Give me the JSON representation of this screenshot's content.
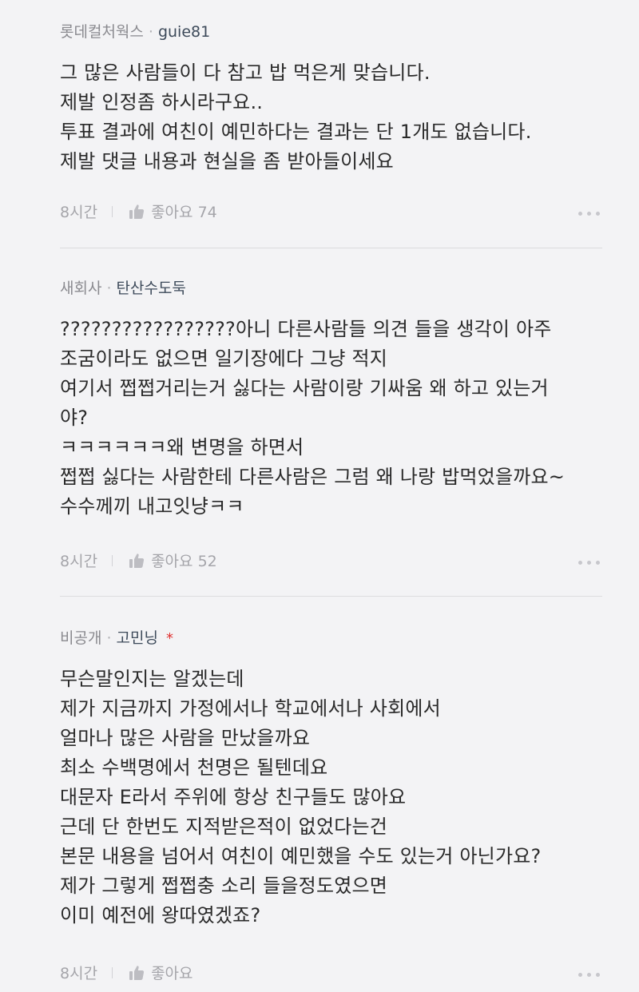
{
  "comments": [
    {
      "company": "롯데컬처웍스",
      "separator": "·",
      "nickname": "guie81",
      "lines": [
        "그 많은 사람들이 다 참고 밥 먹은게 맞습니다.",
        "제발 인정좀 하시라구요..",
        "투표 결과에 여친이 예민하다는 결과는 단 1개도 없습니다.",
        "제발 댓글 내용과 현실을 좀 받아들이세요"
      ],
      "time": "8시간",
      "like_label": "좋아요",
      "like_count": "74"
    },
    {
      "company": "새회사",
      "separator": "·",
      "nickname": "탄산수도둑",
      "lines": [
        "?????????????????아니 다른사람들 의견 들을 생각이 아주",
        "조굼이라도 없으면 일기장에다 그냥 적지",
        "여기서 쩝쩝거리는거 싫다는 사람이랑 기싸움 왜 하고 있는거",
        "야?",
        "ㅋㅋㅋㅋㅋㅋ왜 변명을 하면서",
        "쩝쩝 싫다는 사람한테 다른사람은 그럼 왜 나랑 밥먹었을까요~",
        "수수께끼 내고잇냥ㅋㅋ"
      ],
      "time": "8시간",
      "like_label": "좋아요",
      "like_count": "52"
    },
    {
      "company": "비공개",
      "separator": "·",
      "nickname": "고민닝",
      "author_mark": "*",
      "lines": [
        "무슨말인지는 알겠는데",
        "제가 지금까지 가정에서나 학교에서나 사회에서",
        "얼마나 많은 사람을 만났을까요",
        "최소 수백명에서 천명은 될텐데요",
        "대문자 E라서 주위에 항상 친구들도 많아요",
        "근데 단 한번도 지적받은적이 없었다는건",
        "본문 내용을 넘어서 여친이 예민했을 수도 있는거 아닌가요?",
        "제가 그렇게 쩝쩝충 소리 들을정도였으면",
        "이미 예전에 왕따였겠죠?"
      ],
      "time": "8시간",
      "like_label": "좋아요",
      "like_count": ""
    }
  ],
  "icons": {
    "like": "thumbs-up-icon",
    "more": "more-dots-icon"
  },
  "colors": {
    "background": "#f3f3f5",
    "nickname": "#3d4a5a",
    "meta": "#8a8a8f",
    "author_mark": "#e03030"
  }
}
